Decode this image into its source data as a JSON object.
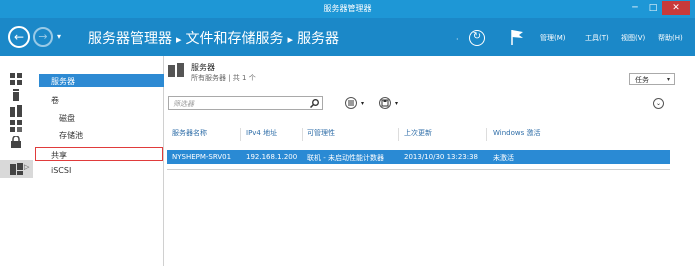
{
  "window": {
    "title": "服务器管理器",
    "min": "─",
    "max": "□",
    "close": "✕"
  },
  "header": {
    "back": "←",
    "forward": "→",
    "dropdown": "▾",
    "breadcrumb": [
      "服务器管理器",
      "文件和存储服务",
      "服务器"
    ],
    "separator": "▸",
    "dot": "·",
    "refresh": "↻",
    "menus": {
      "manage": "管理(M)",
      "tools": "工具(T)",
      "view": "视图(V)",
      "help": "帮助(H)"
    }
  },
  "rail": {
    "arrow": "▷"
  },
  "sidebar": {
    "items": [
      "服务器",
      "卷",
      "磁盘",
      "存储池",
      "共享",
      "iSCSI"
    ]
  },
  "main": {
    "title": "服务器",
    "subtitle": "所有服务器 | 共 1 个",
    "tasks": "任务",
    "tasks_caret": "▾",
    "filter_placeholder": "筛选器",
    "list_caret": "▾",
    "save_caret": "▾",
    "expand": "⌄",
    "columns": [
      "服务器名称",
      "IPv4 地址",
      "可管理性",
      "上次更新",
      "Windows 激活"
    ],
    "rows": [
      {
        "name": "NYSHEPM-SRV01",
        "ip": "192.168.1.200",
        "manageability": "联机 - 未启动性能计数器",
        "last_update": "2013/10/30 13:23:38",
        "activation": "未激活"
      }
    ]
  },
  "colors": {
    "titlebar": "#1e97d6",
    "header": "#1b88c8",
    "selection": "#2a8ad4",
    "highlight_border": "#e03b3b"
  }
}
